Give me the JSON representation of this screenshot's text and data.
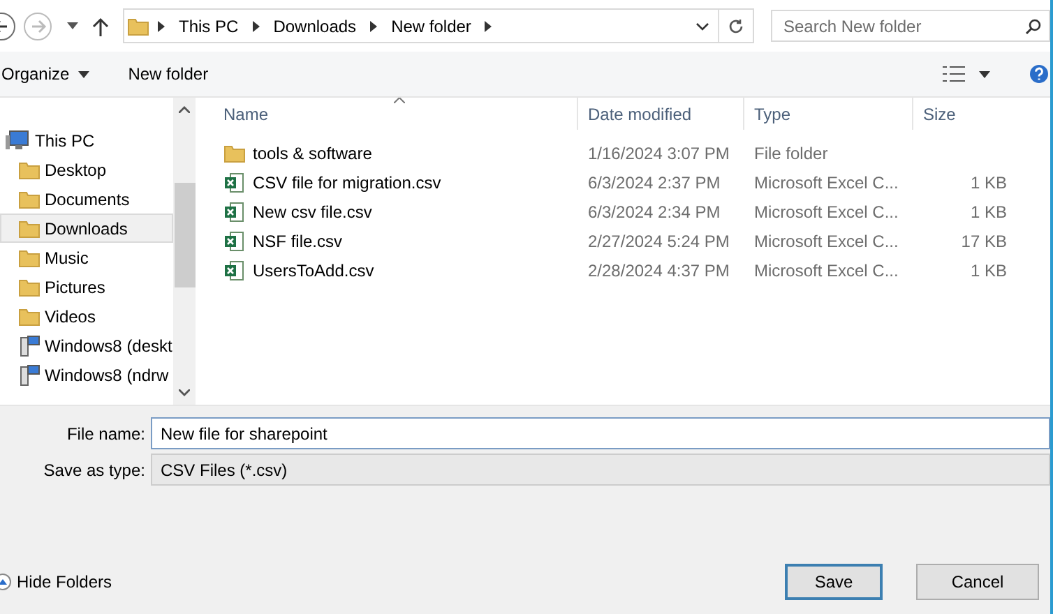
{
  "address_bar": {
    "crumbs": [
      "This PC",
      "Downloads",
      "New folder"
    ]
  },
  "search": {
    "placeholder": "Search New folder"
  },
  "toolbar": {
    "organize": "Organize",
    "new_folder": "New folder"
  },
  "sidebar": {
    "items": [
      {
        "label": "This PC",
        "kind": "pc",
        "selected": false
      },
      {
        "label": "Desktop",
        "kind": "folder",
        "selected": false
      },
      {
        "label": "Documents",
        "kind": "folder",
        "selected": false
      },
      {
        "label": "Downloads",
        "kind": "folder",
        "selected": true
      },
      {
        "label": "Music",
        "kind": "folder",
        "selected": false
      },
      {
        "label": "Pictures",
        "kind": "folder",
        "selected": false
      },
      {
        "label": "Videos",
        "kind": "folder",
        "selected": false
      },
      {
        "label": "Windows8 (deskt",
        "kind": "network",
        "selected": false
      },
      {
        "label": "Windows8 (ndrw",
        "kind": "network",
        "selected": false
      }
    ]
  },
  "table": {
    "columns": [
      "Name",
      "Date modified",
      "Type",
      "Size"
    ],
    "rows": [
      {
        "name": "tools & software",
        "kind": "folder",
        "date": "1/16/2024 3:07 PM",
        "type": "File folder",
        "size": ""
      },
      {
        "name": "CSV file for migration.csv",
        "kind": "excel",
        "date": "6/3/2024 2:37 PM",
        "type": "Microsoft Excel C...",
        "size": "1 KB"
      },
      {
        "name": "New csv file.csv",
        "kind": "excel",
        "date": "6/3/2024 2:34 PM",
        "type": "Microsoft Excel C...",
        "size": "1 KB"
      },
      {
        "name": "NSF file.csv",
        "kind": "excel",
        "date": "2/27/2024 5:24 PM",
        "type": "Microsoft Excel C...",
        "size": "17 KB"
      },
      {
        "name": "UsersToAdd.csv",
        "kind": "excel",
        "date": "2/28/2024 4:37 PM",
        "type": "Microsoft Excel C...",
        "size": "1 KB"
      }
    ]
  },
  "form": {
    "file_name_label": "File name:",
    "file_name": "New file for sharepoint",
    "type_label": "Save as type:",
    "type_value": "CSV Files (*.csv)"
  },
  "footer": {
    "hide_folders": "Hide Folders",
    "buttons": [
      "Save",
      "Cancel"
    ]
  }
}
